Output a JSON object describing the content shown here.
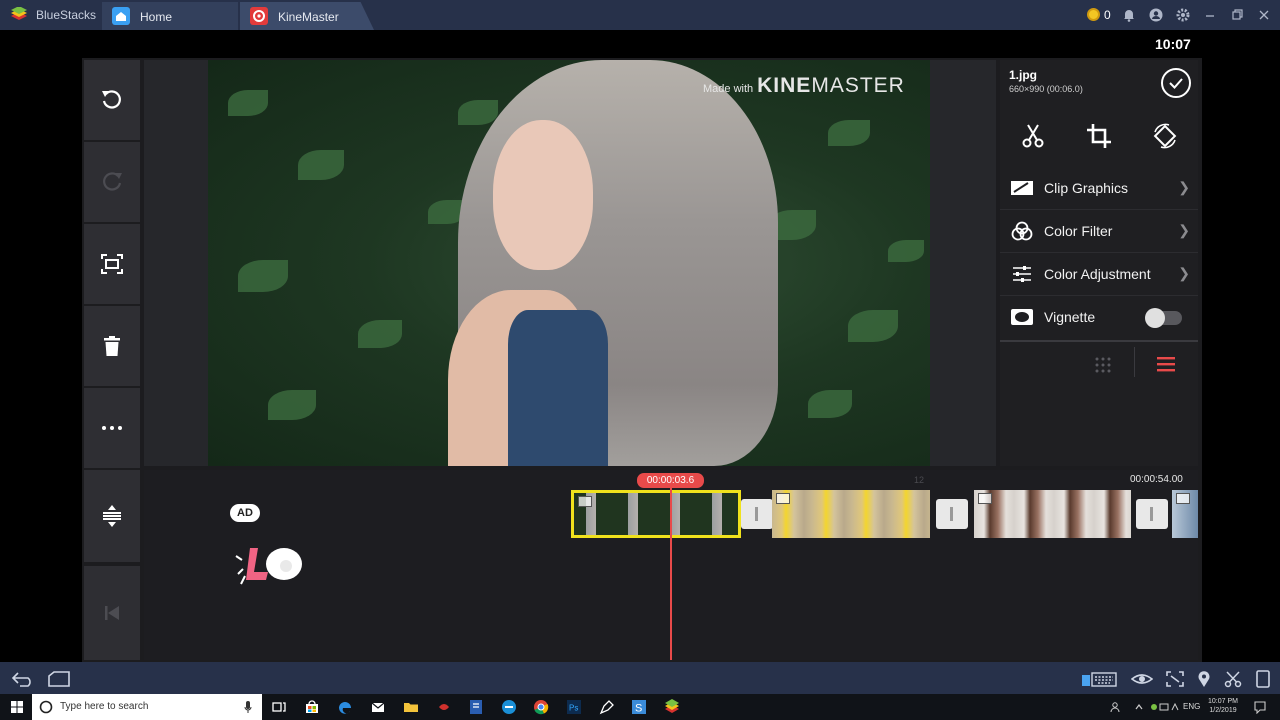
{
  "titlebar": {
    "app_name": "BlueStacks",
    "tabs": [
      {
        "label": "Home",
        "icon": "home-icon"
      },
      {
        "label": "KineMaster",
        "icon": "kinemaster-icon"
      }
    ],
    "coins": "0"
  },
  "statusbar": {
    "time": "10:07"
  },
  "preview": {
    "watermark_prefix": "Made with",
    "watermark_brand_a": "KINE",
    "watermark_brand_b": "MASTER"
  },
  "clip_panel": {
    "clip_name": "1.jpg",
    "clip_info": "660×990 (00:06.0)",
    "menu": [
      {
        "label": "Clip Graphics",
        "icon": "clip-graphics-icon"
      },
      {
        "label": "Color Filter",
        "icon": "color-filter-icon"
      },
      {
        "label": "Color Adjustment",
        "icon": "color-adjustment-icon"
      },
      {
        "label": "Vignette",
        "icon": "vignette-icon"
      }
    ],
    "vignette_on": false
  },
  "timeline": {
    "ad_badge": "AD",
    "current_time": "00:00:03.6",
    "total_time": "00:00:54.00",
    "marker": "12"
  },
  "taskbar": {
    "search_placeholder": "Type here to search",
    "language": "ENG",
    "clock_time": "10:07 PM",
    "clock_date": "1/2/2019"
  },
  "colors": {
    "accent_red": "#e84a4a",
    "selected_clip": "#f0e21c",
    "titlebar": "#27314a"
  }
}
